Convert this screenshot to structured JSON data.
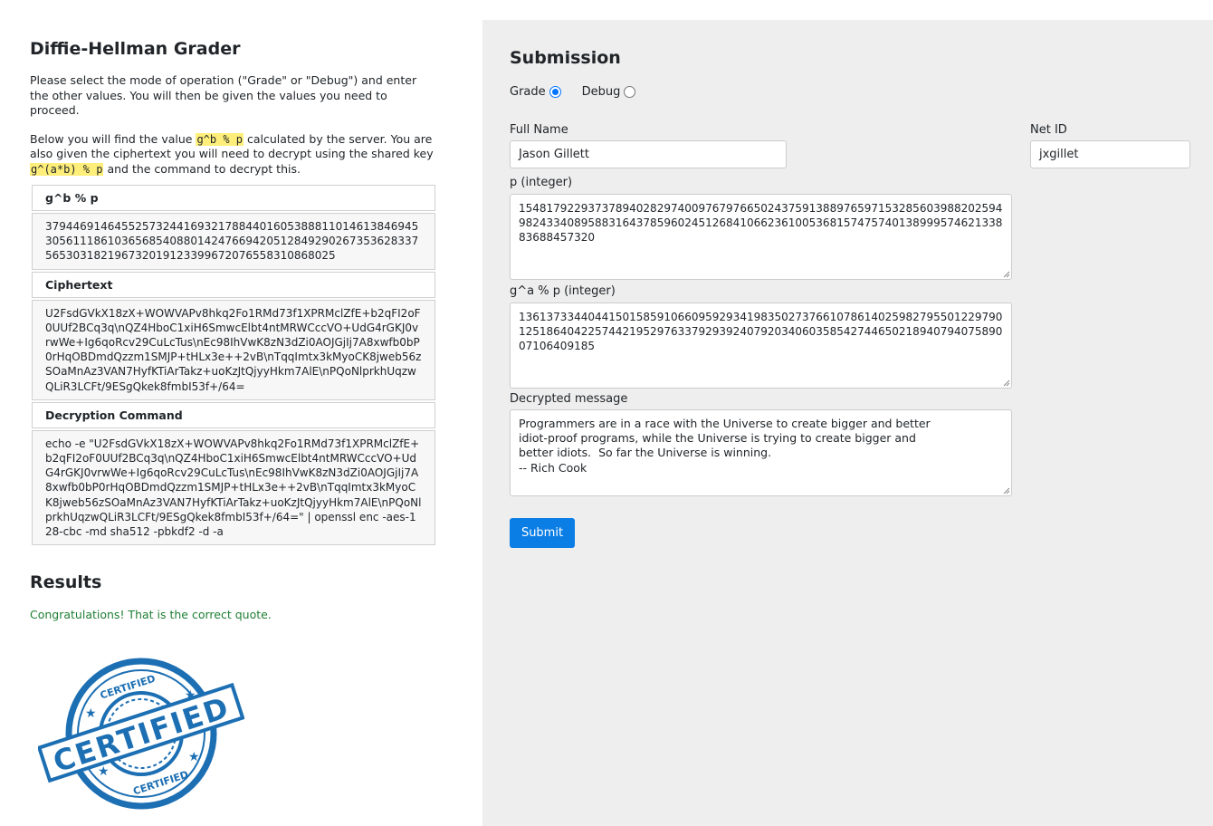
{
  "grader": {
    "title": "Diffie-Hellman Grader",
    "intro1": "Please select the mode of operation (\"Grade\" or \"Debug\") and enter the other values. You will then be given the values you need to proceed.",
    "intro2_a": "Below you will find the value ",
    "intro2_code1": "g^b % p",
    "intro2_b": " calculated by the server. You are also given the ciphertext you will need to decrypt using the shared key ",
    "intro2_code2": "g^(a*b) % p",
    "intro2_c": " and the command to decrypt this.",
    "gbp_label": "g^b % p",
    "gbp_value": "379446914645525732441693217884401605388811014613846945305611186103656854088014247669420512849290267353628337565303182196732019123399672076558310868025",
    "cipher_label": "Ciphertext",
    "cipher_value": "U2FsdGVkX18zX+WOWVAPv8hkq2Fo1RMd73f1XPRMclZfE+b2qFI2oF0UUf2BCq3q\\nQZ4HboC1xiH6SmwcElbt4ntMRWCccVO+UdG4rGKJ0vrwWe+Ig6qoRcv29CuLcTus\\nEc98IhVwK8zN3dZi0AOJGjIj7A8xwfb0bP0rHqOBDmdQzzm1SMJP+tHLx3e++2vB\\nTqqImtx3kMyoCK8jweb56zSOaMnAz3VAN7HyfKTiArTakz+uoKzJtQjyyHkm7AlE\\nPQoNlprkhUqzwQLiR3LCFt/9ESgQkek8fmbI53f+/64=",
    "cmd_label": "Decryption Command",
    "cmd_value": "echo -e \"U2FsdGVkX18zX+WOWVAPv8hkq2Fo1RMd73f1XPRMclZfE+b2qFI2oF0UUf2BCq3q\\nQZ4HboC1xiH6SmwcElbt4ntMRWCccVO+UdG4rGKJ0vrwWe+Ig6qoRcv29CuLcTus\\nEc98IhVwK8zN3dZi0AOJGjIj7A8xwfb0bP0rHqOBDmdQzzm1SMJP+tHLx3e++2vB\\nTqqImtx3kMyoCK8jweb56zSOaMnAz3VAN7HyfKTiArTakz+uoKzJtQjyyHkm7AlE\\nPQoNlprkhUqzwQLiR3LCFt/9ESgQkek8fmbI53f+/64=\" | openssl enc -aes-128-cbc -md sha512 -pbkdf2 -d -a"
  },
  "results": {
    "title": "Results",
    "message": "Congratulations! That is the correct quote.",
    "stamp_text_big": "CERTIFIED",
    "stamp_text_small": "CERTIFIED"
  },
  "submission": {
    "title": "Submission",
    "mode_grade": "Grade",
    "mode_debug": "Debug",
    "selected_mode": "Grade",
    "full_name_label": "Full Name",
    "full_name_value": "Jason Gillett",
    "net_id_label": "Net ID",
    "net_id_value": "jxgillet",
    "p_label": "p (integer)",
    "p_value": "15481792293737894028297400976797665024375913889765971532856039882025949824334089588316437859602451268410662361005368157475740138999574621338836884573​20",
    "ga_label": "g^a % p (integer)",
    "ga_value": "13613733440441501585910660959293419835027376610786140259827955012297901251864042257442195297633792939240792034060358542744650218940794075890071064091​85",
    "msg_label": "Decrypted message",
    "msg_value": "Programmers are in a race with the Universe to create bigger and better\nidiot-proof programs, while the Universe is trying to create bigger and\nbetter idiots.  So far the Universe is winning.\n-- Rich Cook",
    "submit_label": "Submit"
  },
  "colors": {
    "accent": "#0b7ee6",
    "success": "#1e7e34",
    "highlight": "#ffef7a",
    "stamp": "#1c6fb3"
  }
}
